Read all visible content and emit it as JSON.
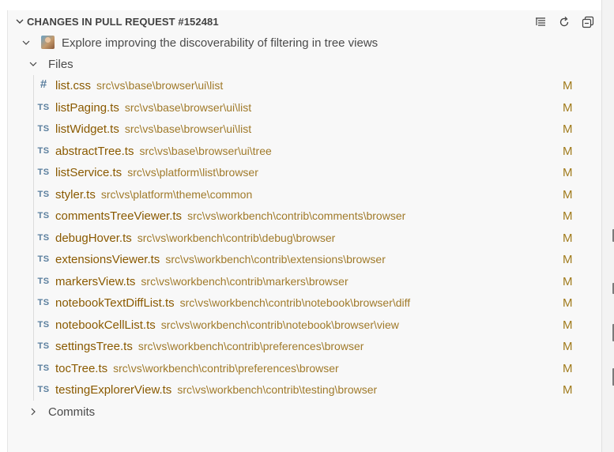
{
  "header": {
    "title": "CHANGES IN PULL REQUEST #152481",
    "actions": [
      {
        "icon": "tree-view-icon",
        "tooltip": ""
      },
      {
        "icon": "refresh-icon",
        "tooltip": ""
      },
      {
        "icon": "collapse-all-icon",
        "tooltip": ""
      }
    ]
  },
  "pull_request": {
    "title": "Explore improving the discoverability of filtering in tree views",
    "avatar_icon": "user-avatar"
  },
  "files_group": {
    "label": "Files",
    "items": [
      {
        "icon": "#",
        "icon_type": "css",
        "name": "list.css",
        "path": "src\\vs\\base\\browser\\ui\\list",
        "status": "M"
      },
      {
        "icon": "TS",
        "icon_type": "ts",
        "name": "listPaging.ts",
        "path": "src\\vs\\base\\browser\\ui\\list",
        "status": "M"
      },
      {
        "icon": "TS",
        "icon_type": "ts",
        "name": "listWidget.ts",
        "path": "src\\vs\\base\\browser\\ui\\list",
        "status": "M"
      },
      {
        "icon": "TS",
        "icon_type": "ts",
        "name": "abstractTree.ts",
        "path": "src\\vs\\base\\browser\\ui\\tree",
        "status": "M"
      },
      {
        "icon": "TS",
        "icon_type": "ts",
        "name": "listService.ts",
        "path": "src\\vs\\platform\\list\\browser",
        "status": "M"
      },
      {
        "icon": "TS",
        "icon_type": "ts",
        "name": "styler.ts",
        "path": "src\\vs\\platform\\theme\\common",
        "status": "M"
      },
      {
        "icon": "TS",
        "icon_type": "ts",
        "name": "commentsTreeViewer.ts",
        "path": "src\\vs\\workbench\\contrib\\comments\\browser",
        "status": "M"
      },
      {
        "icon": "TS",
        "icon_type": "ts",
        "name": "debugHover.ts",
        "path": "src\\vs\\workbench\\contrib\\debug\\browser",
        "status": "M"
      },
      {
        "icon": "TS",
        "icon_type": "ts",
        "name": "extensionsViewer.ts",
        "path": "src\\vs\\workbench\\contrib\\extensions\\browser",
        "status": "M"
      },
      {
        "icon": "TS",
        "icon_type": "ts",
        "name": "markersView.ts",
        "path": "src\\vs\\workbench\\contrib\\markers\\browser",
        "status": "M"
      },
      {
        "icon": "TS",
        "icon_type": "ts",
        "name": "notebookTextDiffList.ts",
        "path": "src\\vs\\workbench\\contrib\\notebook\\browser\\diff",
        "status": "M"
      },
      {
        "icon": "TS",
        "icon_type": "ts",
        "name": "notebookCellList.ts",
        "path": "src\\vs\\workbench\\contrib\\notebook\\browser\\view",
        "status": "M"
      },
      {
        "icon": "TS",
        "icon_type": "ts",
        "name": "settingsTree.ts",
        "path": "src\\vs\\workbench\\contrib\\preferences\\browser",
        "status": "M"
      },
      {
        "icon": "TS",
        "icon_type": "ts",
        "name": "tocTree.ts",
        "path": "src\\vs\\workbench\\contrib\\preferences\\browser",
        "status": "M"
      },
      {
        "icon": "TS",
        "icon_type": "ts",
        "name": "testingExplorerView.ts",
        "path": "src\\vs\\workbench\\contrib\\testing\\browser",
        "status": "M"
      }
    ]
  },
  "commits_group": {
    "label": "Commits"
  },
  "colors": {
    "file_name": "#8a5a00",
    "file_path": "#a07a2a",
    "status_modified": "#a07a1a",
    "ts_icon": "#5b7f9e"
  }
}
